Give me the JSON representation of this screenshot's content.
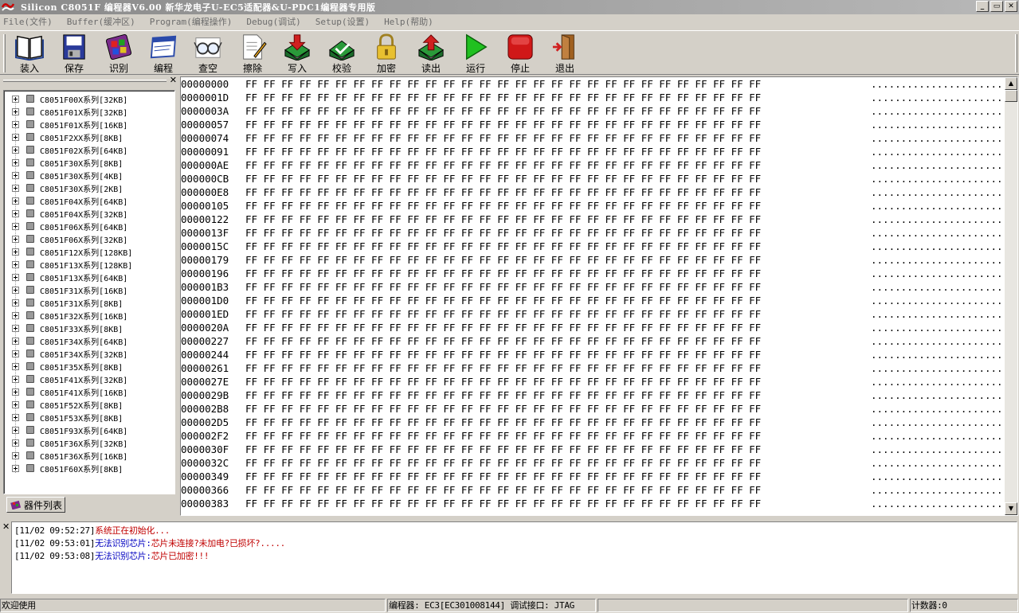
{
  "window": {
    "title": "Silicon C8051F 编程器V6.00  新华龙电子U-EC5适配器&U-PDC1编程器专用版",
    "controls": [
      "_",
      "▭",
      "✕"
    ]
  },
  "menu": [
    {
      "label": "File(文件)"
    },
    {
      "label": "Buffer(缓冲区)"
    },
    {
      "label": "Program(编程操作)"
    },
    {
      "label": "Debug(调试)"
    },
    {
      "label": "Setup(设置)"
    },
    {
      "label": "Help(帮助)"
    }
  ],
  "toolbar": [
    {
      "label": "装入",
      "icon": "book-icon"
    },
    {
      "label": "保存",
      "icon": "floppy-save-icon"
    },
    {
      "label": "识别",
      "icon": "chip-identify-icon"
    },
    {
      "label": "编程",
      "icon": "window-program-icon"
    },
    {
      "label": "查空",
      "icon": "glasses-blank-check-icon"
    },
    {
      "label": "擦除",
      "icon": "document-erase-icon"
    },
    {
      "label": "写入",
      "icon": "write-arrow-icon"
    },
    {
      "label": "校验",
      "icon": "verify-check-icon"
    },
    {
      "label": "加密",
      "icon": "lock-icon"
    },
    {
      "label": "读出",
      "icon": "read-arrow-icon"
    },
    {
      "label": "运行",
      "icon": "play-icon"
    },
    {
      "label": "停止",
      "icon": "stop-icon"
    },
    {
      "label": "退出",
      "icon": "exit-door-icon"
    }
  ],
  "device_tree": {
    "close_glyph": "✕",
    "tab_label": "器件列表",
    "items": [
      "C8051F00X系列[32KB]",
      "C8051F01X系列[32KB]",
      "C8051F01X系列[16KB]",
      "C8051F2XX系列[8KB]",
      "C8051F02X系列[64KB]",
      "C8051F30X系列[8KB]",
      "C8051F30X系列[4KB]",
      "C8051F30X系列[2KB]",
      "C8051F04X系列[64KB]",
      "C8051F04X系列[32KB]",
      "C8051F06X系列[64KB]",
      "C8051F06X系列[32KB]",
      "C8051F12X系列[128KB]",
      "C8051F13X系列[128KB]",
      "C8051F13X系列[64KB]",
      "C8051F31X系列[16KB]",
      "C8051F31X系列[8KB]",
      "C8051F32X系列[16KB]",
      "C8051F33X系列[8KB]",
      "C8051F34X系列[64KB]",
      "C8051F34X系列[32KB]",
      "C8051F35X系列[8KB]",
      "C8051F41X系列[32KB]",
      "C8051F41X系列[16KB]",
      "C8051F52X系列[8KB]",
      "C8051F53X系列[8KB]",
      "C8051F93X系列[64KB]",
      "C8051F36X系列[32KB]",
      "C8051F36X系列[16KB]",
      "C8051F60X系列[8KB]"
    ]
  },
  "hex_view": {
    "bytes": "FF FF FF FF FF FF FF FF FF FF FF FF FF FF FF FF FF FF FF FF FF FF FF FF FF FF FF FF FF",
    "ascii": ".............................",
    "addresses": [
      "00000000",
      "0000001D",
      "0000003A",
      "00000057",
      "00000074",
      "00000091",
      "000000AE",
      "000000CB",
      "000000E8",
      "00000105",
      "00000122",
      "0000013F",
      "0000015C",
      "00000179",
      "00000196",
      "000001B3",
      "000001D0",
      "000001ED",
      "0000020A",
      "00000227",
      "00000244",
      "00000261",
      "0000027E",
      "0000029B",
      "000002B8",
      "000002D5",
      "000002F2",
      "0000030F",
      "0000032C",
      "00000349",
      "00000366",
      "00000383"
    ]
  },
  "log": {
    "close_glyph": "✕",
    "lines": [
      {
        "ts": "[11/02 09:52:27]",
        "a": "",
        "b": "系统正在初始化..."
      },
      {
        "ts": "[11/02 09:53:01]",
        "a": "无法识别芯片:",
        "b": "芯片未连接?未加电?已损坏?....."
      },
      {
        "ts": "[11/02 09:53:08]",
        "a": "无法识别芯片:",
        "b": "芯片已加密!!!"
      }
    ]
  },
  "status": {
    "welcome": "欢迎使用",
    "programmer": "编程器: EC3[EC301008144]  调试接口: JTAG",
    "counter": "计数器:0"
  }
}
